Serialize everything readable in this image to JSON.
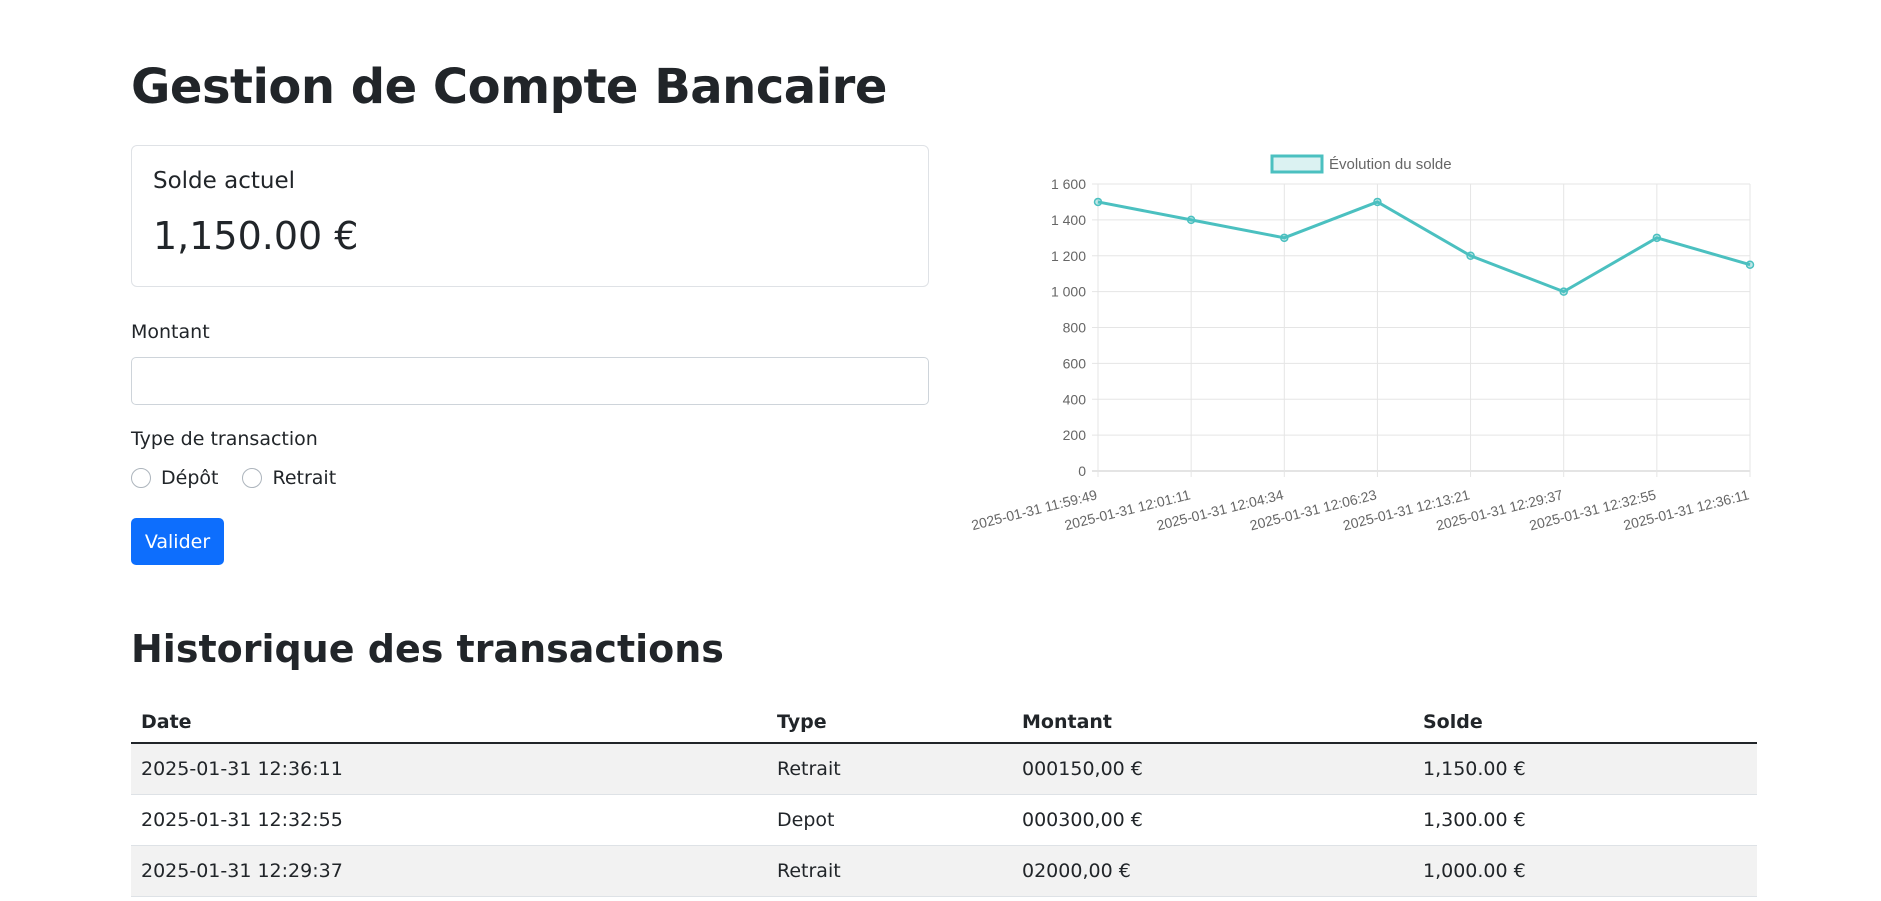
{
  "page": {
    "title": "Gestion de Compte Bancaire"
  },
  "balance": {
    "label": "Solde actuel",
    "value": "1,150.00 €"
  },
  "form": {
    "amount_label": "Montant",
    "amount_value": "",
    "type_label": "Type de transaction",
    "options": [
      {
        "label": "Dépôt",
        "selected": false
      },
      {
        "label": "Retrait",
        "selected": false
      }
    ],
    "submit_label": "Valider",
    "submit_color": "#0d6efd"
  },
  "chart_data": {
    "type": "line",
    "title": "",
    "legend": [
      "Évolution du solde"
    ],
    "legend_position": "top-center",
    "color": "#4bc0c0",
    "x": [
      "2025-01-31 11:59:49",
      "2025-01-31 12:01:11",
      "2025-01-31 12:04:34",
      "2025-01-31 12:06:23",
      "2025-01-31 12:13:21",
      "2025-01-31 12:29:37",
      "2025-01-31 12:32:55",
      "2025-01-31 12:36:11"
    ],
    "series": [
      {
        "name": "Évolution du solde",
        "values": [
          1500,
          1400,
          1300,
          1500,
          1200,
          1000,
          1300,
          1150
        ]
      }
    ],
    "ylim": [
      0,
      1600
    ],
    "yticks": [
      "0",
      "200",
      "400",
      "600",
      "800",
      "1 000",
      "1 200",
      "1 400",
      "1 600"
    ],
    "grid": true
  },
  "history": {
    "title": "Historique des transactions",
    "columns": [
      "Date",
      "Type",
      "Montant",
      "Solde"
    ],
    "rows": [
      [
        "2025-01-31 12:36:11",
        "Retrait",
        "000150,00 €",
        "1,150.00 €"
      ],
      [
        "2025-01-31 12:32:55",
        "Depot",
        "000300,00 €",
        "1,300.00 €"
      ],
      [
        "2025-01-31 12:29:37",
        "Retrait",
        "02000,00 €",
        "1,000.00 €"
      ]
    ]
  }
}
